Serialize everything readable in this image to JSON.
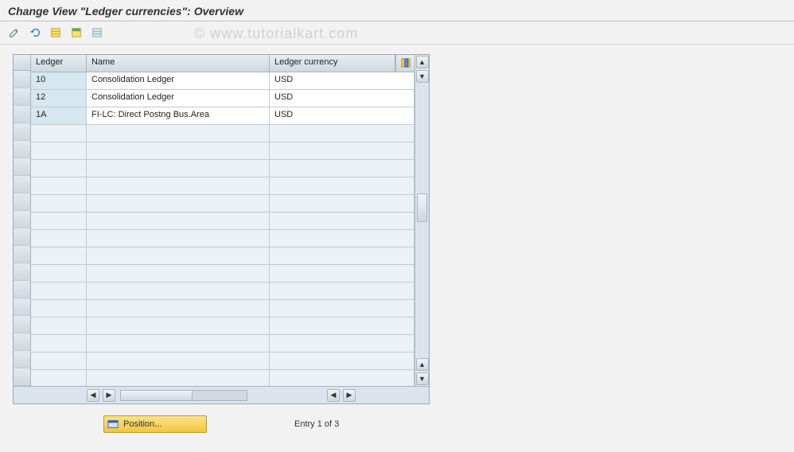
{
  "header": {
    "title": "Change View \"Ledger currencies\": Overview"
  },
  "watermark": "© www.tutorialkart.com",
  "toolbar": {
    "icons": [
      "change-icon",
      "undo-icon",
      "select-all-icon",
      "select-block-icon",
      "deselect-all-icon"
    ]
  },
  "columns": {
    "ledger": "Ledger",
    "name": "Name",
    "currency": "Ledger currency"
  },
  "rows": [
    {
      "ledger": "10",
      "name": "Consolidation Ledger",
      "currency": "USD"
    },
    {
      "ledger": "12",
      "name": "Consolidation Ledger",
      "currency": "USD"
    },
    {
      "ledger": "1A",
      "name": "FI-LC: Direct Postng Bus.Area",
      "currency": "USD"
    }
  ],
  "empty_rows": 15,
  "footer": {
    "position_label": "Position...",
    "status": "Entry 1 of 3"
  }
}
